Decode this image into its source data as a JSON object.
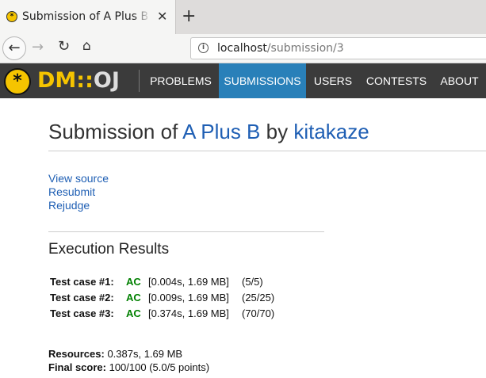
{
  "browser": {
    "tab_title": "Submission of A Plus B by kitakaze",
    "url_host": "localhost",
    "url_path": "/submission/3"
  },
  "navbar": {
    "logo_dm": "DM",
    "logo_sep": "::",
    "logo_oj": "OJ",
    "items": [
      {
        "label": "PROBLEMS",
        "active": false
      },
      {
        "label": "SUBMISSIONS",
        "active": true
      },
      {
        "label": "USERS",
        "active": false
      },
      {
        "label": "CONTESTS",
        "active": false
      },
      {
        "label": "ABOUT",
        "active": false
      }
    ],
    "active_color": "#2980b9"
  },
  "page": {
    "title_prefix": "Submission of",
    "problem": "A Plus B",
    "title_by": "by",
    "user": "kitakaze",
    "links": [
      "View source",
      "Resubmit",
      "Rejudge"
    ],
    "section_title": "Execution Results",
    "test_cases": [
      {
        "label": "Test case #1:",
        "status": "AC",
        "info": "[0.004s, 1.69 MB]",
        "points": "(5/5)"
      },
      {
        "label": "Test case #2:",
        "status": "AC",
        "info": "[0.009s, 1.69 MB]",
        "points": "(25/25)"
      },
      {
        "label": "Test case #3:",
        "status": "AC",
        "info": "[0.374s, 1.69 MB]",
        "points": "(70/70)"
      }
    ],
    "resources_label": "Resources:",
    "resources_value": "0.387s, 1.69 MB",
    "score_label": "Final score:",
    "score_value": "100/100 (5.0/5 points)"
  }
}
